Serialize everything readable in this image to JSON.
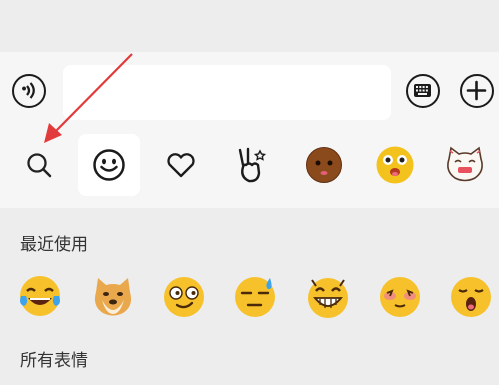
{
  "input_bar": {
    "voice_icon": "voice-input-icon",
    "keyboard_icon": "keyboard-icon",
    "plus_icon": "plus-icon",
    "text_value": ""
  },
  "tabs": [
    {
      "icon": "search-icon"
    },
    {
      "icon": "smiley-face-icon",
      "active": true
    },
    {
      "icon": "heart-icon"
    },
    {
      "icon": "victory-hand-icon"
    },
    {
      "icon": "brown-face-emoji"
    },
    {
      "icon": "gold-face-emoji"
    },
    {
      "icon": "cat-sticker-icon"
    }
  ],
  "sections": {
    "recent_title": "最近使用",
    "all_title": "所有表情"
  },
  "recent_emojis": [
    "tears-of-joy-emoji",
    "doge-emoji",
    "smirk-emoji",
    "cold-sweat-emoji",
    "grin-emoji",
    "blushing-emoji",
    "yawn-emoji"
  ],
  "annotation": {
    "type": "red-arrow",
    "target": "search-icon",
    "color": "#e23b3b"
  }
}
